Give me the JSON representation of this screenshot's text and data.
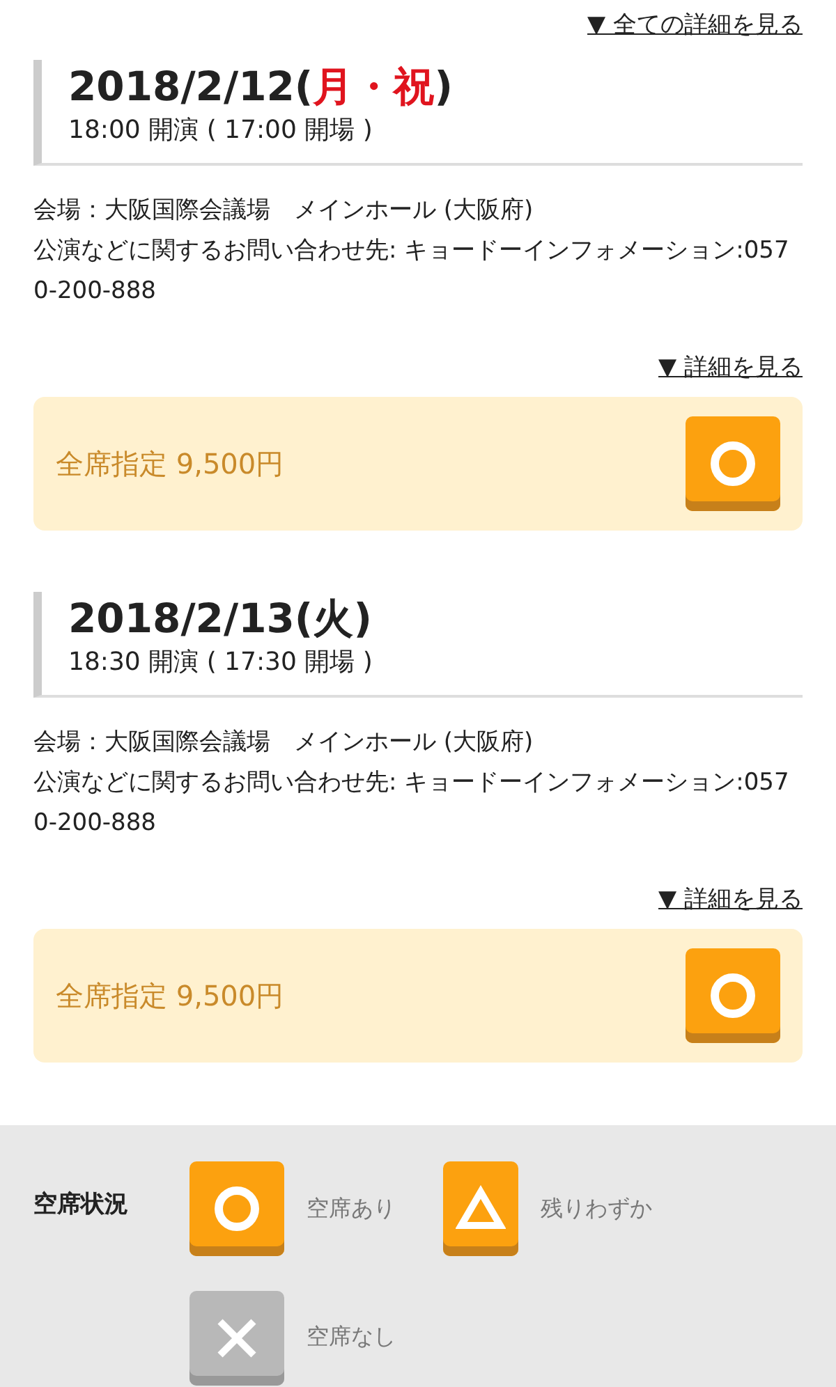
{
  "all_details_link": "▼ 全ての詳細を見る",
  "performances": [
    {
      "date": "2018/2/12(",
      "day": "月・祝",
      "date_end": ")",
      "holiday": true,
      "time": "18:00 開演 ( 17:00 開場 )",
      "venue": "会場：大阪国際会議場　メインホール (大阪府)",
      "inquiry": "公演などに関するお問い合わせ先: キョードーインフォメーション:0570-200-888",
      "details_link": "▼ 詳細を見る",
      "ticket": {
        "label": "全席指定 9,500円",
        "kind": "available"
      }
    },
    {
      "date": "2018/2/13(",
      "day": "火",
      "date_end": ")",
      "holiday": false,
      "time": "18:30 開演 ( 17:30 開場 )",
      "venue": "会場：大阪国際会議場　メインホール (大阪府)",
      "inquiry": "公演などに関するお問い合わせ先: キョードーインフォメーション:0570-200-888",
      "details_link": "▼ 詳細を見る",
      "ticket": {
        "label": "全席指定 9,500円",
        "kind": "available"
      }
    }
  ],
  "legend": {
    "title": "空席状況",
    "items": [
      {
        "kind": "available",
        "label": "空席あり"
      },
      {
        "kind": "few",
        "label": "残りわずか"
      },
      {
        "kind": "none",
        "label": "空席なし"
      }
    ]
  }
}
